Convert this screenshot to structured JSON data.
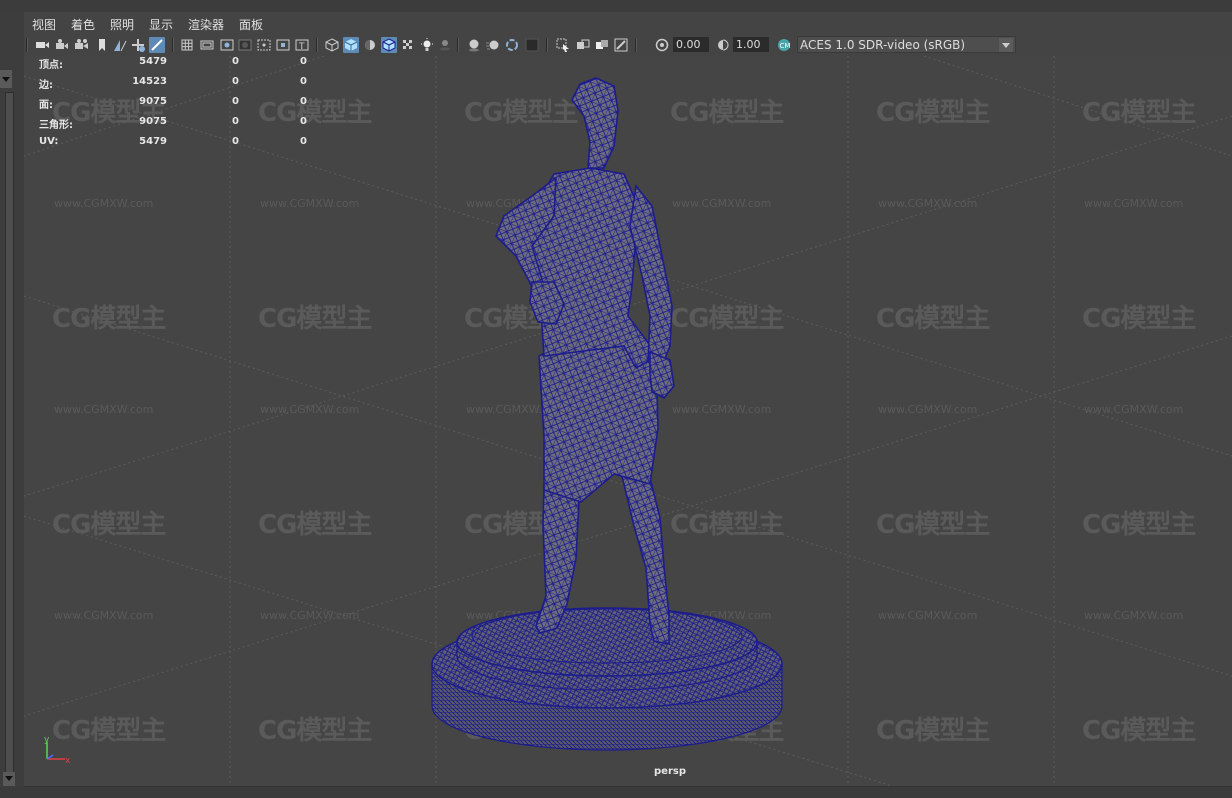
{
  "menu": [
    "视图",
    "着色",
    "照明",
    "显示",
    "渲染器",
    "面板"
  ],
  "toolbar": {
    "exposure_value": "0.00",
    "gamma_value": "1.00",
    "color_space": "ACES 1.0 SDR-video (sRGB)"
  },
  "hud_stats": [
    {
      "label": "顶点:",
      "v1": "5479",
      "v2": "0",
      "v3": "0"
    },
    {
      "label": "边:",
      "v1": "14523",
      "v2": "0",
      "v3": "0"
    },
    {
      "label": "面:",
      "v1": "9075",
      "v2": "0",
      "v3": "0"
    },
    {
      "label": "三角形:",
      "v1": "9075",
      "v2": "0",
      "v3": "0"
    },
    {
      "label": "UV:",
      "v1": "5479",
      "v2": "0",
      "v3": "0"
    }
  ],
  "camera_label": "persp",
  "axis_labels": {
    "y": "y",
    "x": "x"
  },
  "watermark": {
    "logo": "CG模型主",
    "url": "www.CGMXW.com"
  },
  "colors": {
    "background": "#444444",
    "wireframe": "#1c1c8c",
    "mesh_fill": "#6c6c7c",
    "active_tool": "#5d8bb5"
  }
}
